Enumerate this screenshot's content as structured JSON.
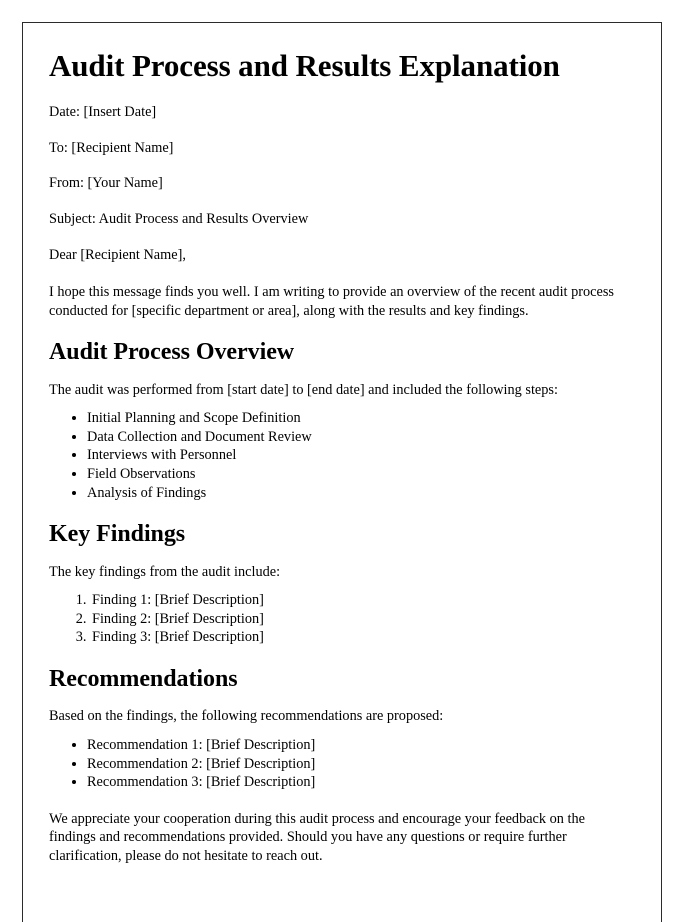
{
  "document": {
    "title": "Audit Process and Results Explanation",
    "meta": [
      {
        "label": "Date",
        "text": "Date: [Insert Date]"
      },
      {
        "label": "To",
        "text": "To: [Recipient Name]"
      },
      {
        "label": "From",
        "text": "From: [Your Name]"
      },
      {
        "label": "Subject",
        "text": "Subject: Audit Process and Results Overview"
      }
    ],
    "salutation": "Dear [Recipient Name],",
    "intro_paragraph": "I hope this message finds you well. I am writing to provide an overview of the recent audit process conducted for [specific department or area], along with the results and key findings.",
    "sections": [
      {
        "heading": "Audit Process Overview",
        "intro": "The audit was performed from [start date] to [end date] and included the following steps:",
        "list_type": "bullet",
        "items": [
          "Initial Planning and Scope Definition",
          "Data Collection and Document Review",
          "Interviews with Personnel",
          "Field Observations",
          "Analysis of Findings"
        ]
      },
      {
        "heading": "Key Findings",
        "intro": "The key findings from the audit include:",
        "list_type": "numbered",
        "items": [
          "Finding 1: [Brief Description]",
          "Finding 2: [Brief Description]",
          "Finding 3: [Brief Description]"
        ]
      },
      {
        "heading": "Recommendations",
        "intro": "Based on the findings, the following recommendations are proposed:",
        "list_type": "bullet",
        "items": [
          "Recommendation 1: [Brief Description]",
          "Recommendation 2: [Brief Description]",
          "Recommendation 3: [Brief Description]"
        ]
      }
    ],
    "closing_paragraph": "We appreciate your cooperation during this audit process and encourage your feedback on the findings and recommendations provided. Should you have any questions or require further clarification, please do not hesitate to reach out.",
    "colors": {
      "page_background": "#ffffff",
      "page_border": "#2b2b2b",
      "text": "#000000"
    }
  }
}
